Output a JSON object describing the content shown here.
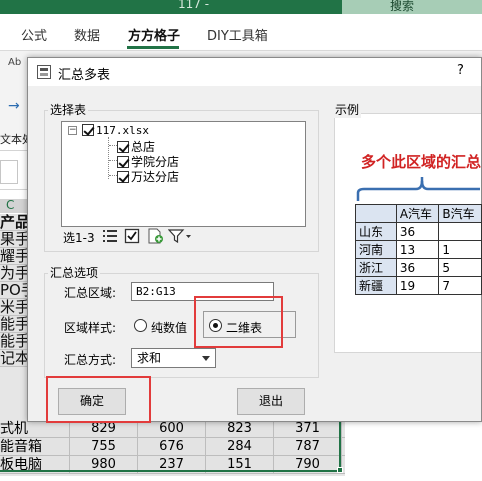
{
  "excel": {
    "window_title_fragment": "117 -",
    "search_label": "搜索",
    "ribbon_tabs": [
      "公式",
      "数据",
      "方方格子",
      "DIY工具箱"
    ],
    "active_tab": "方方格子",
    "ribbon_left_text": "Ab",
    "ribbon_left_text2": "文本处",
    "column_c_header": "C",
    "side_fragments": [
      "产品",
      "果手",
      "耀手",
      "为手",
      "PO手",
      "米手",
      "能手",
      "能手",
      "记本"
    ],
    "rows": [
      {
        "name": "式机",
        "values": [
          "829",
          "600",
          "823",
          "371"
        ]
      },
      {
        "name": "能音箱",
        "values": [
          "755",
          "676",
          "284",
          "787"
        ]
      },
      {
        "name": "板电脑",
        "values": [
          "980",
          "237",
          "151",
          "790"
        ]
      }
    ]
  },
  "dialog": {
    "title": "汇总多表",
    "help": "?",
    "select_table_group": "选择表",
    "tree": {
      "root": "117.xlsx",
      "children": [
        "总店",
        "学院分店",
        "万达分店"
      ]
    },
    "toolbar_label": "选1-3",
    "options_group": "汇总选项",
    "range_label": "汇总区域:",
    "range_value": "B2:G13",
    "style_label": "区域样式:",
    "style_options": [
      "纯数值",
      "二维表"
    ],
    "style_selected": "二维表",
    "method_label": "汇总方式:",
    "method_value": "求和",
    "ok_button": "确定",
    "exit_button": "退出",
    "example_group": "示例",
    "example_title": "多个此区域的汇总",
    "example_table": {
      "headers": [
        "",
        "A汽车",
        "B汽车"
      ],
      "rows": [
        {
          "label": "山东",
          "a": "36",
          "b": ""
        },
        {
          "label": "河南",
          "a": "13",
          "b": "1"
        },
        {
          "label": "浙江",
          "a": "36",
          "b": "5"
        },
        {
          "label": "新疆",
          "a": "19",
          "b": "7"
        }
      ]
    }
  },
  "colors": {
    "excel_green": "#217346",
    "highlight_red": "#e23b3b",
    "example_title_red": "#d12323",
    "example_header_blue": "#dbe4f1",
    "brace_blue": "#3a6fb0"
  }
}
